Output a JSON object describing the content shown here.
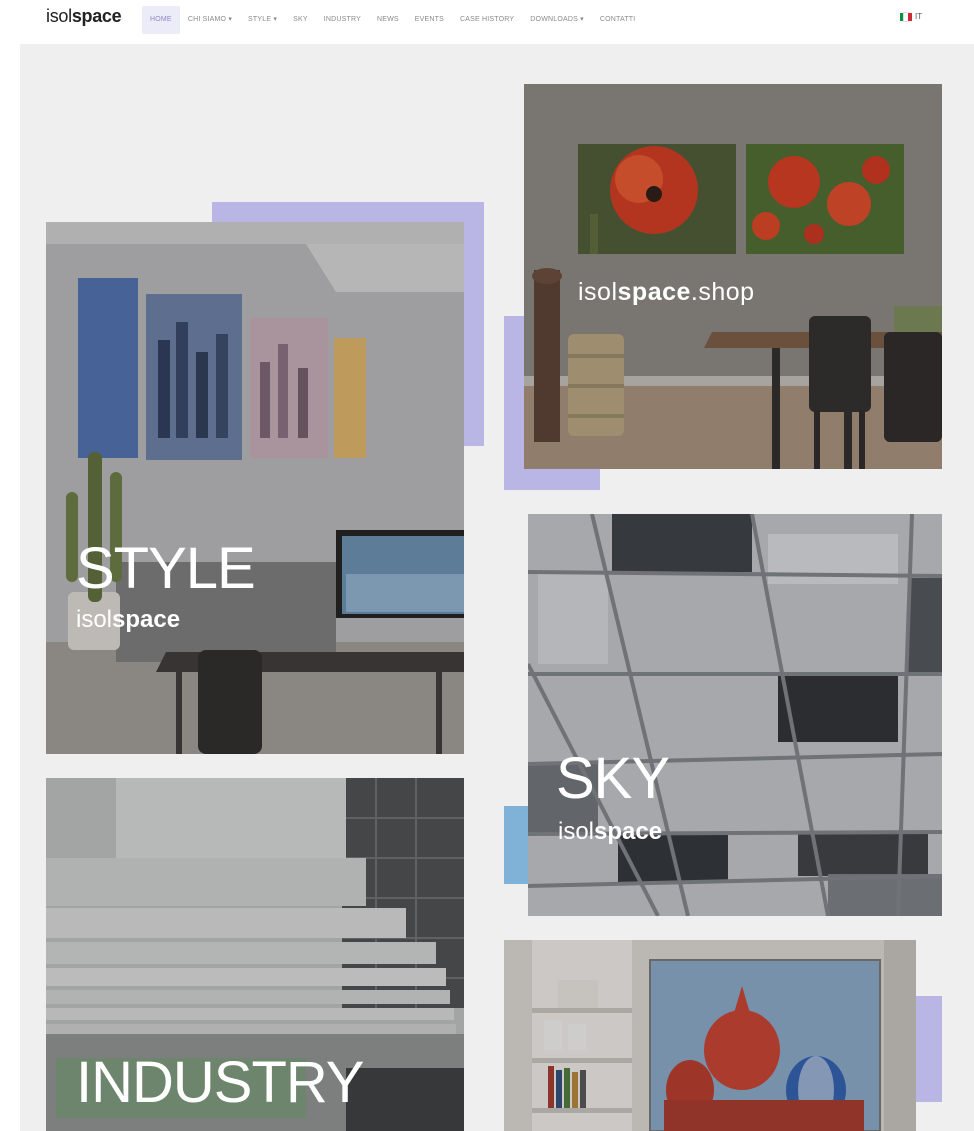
{
  "header": {
    "logo": {
      "light": "isol",
      "bold": "space"
    },
    "nav": [
      {
        "label": "HOME",
        "active": true
      },
      {
        "label": "CHI SIAMO",
        "dropdown": true
      },
      {
        "label": "STYLE",
        "dropdown": true
      },
      {
        "label": "SKY"
      },
      {
        "label": "INDUSTRY"
      },
      {
        "label": "NEWS"
      },
      {
        "label": "EVENTS"
      },
      {
        "label": "CASE HISTORY"
      },
      {
        "label": "DOWNLOADS",
        "dropdown": true
      },
      {
        "label": "CONTATTI"
      }
    ],
    "language": {
      "code": "IT",
      "flag": [
        "#009246",
        "#ffffff",
        "#ce2b37"
      ]
    }
  },
  "tiles": {
    "shop": {
      "label_light": "isol",
      "label_bold": "space",
      "label_suffix": ".shop"
    },
    "style": {
      "title": "STYLE",
      "brand_light": "isol",
      "brand_bold": "space"
    },
    "sky": {
      "title": "SKY",
      "brand_light": "isol",
      "brand_bold": "space"
    },
    "industry": {
      "title": "INDUSTRY"
    }
  },
  "colors": {
    "accent_lavender": "#b9b6e6",
    "accent_blue": "#7fb2d6",
    "nav_active_bg": "#ecebf8",
    "nav_active_text": "#8a87c9",
    "content_bg": "#efefef"
  }
}
